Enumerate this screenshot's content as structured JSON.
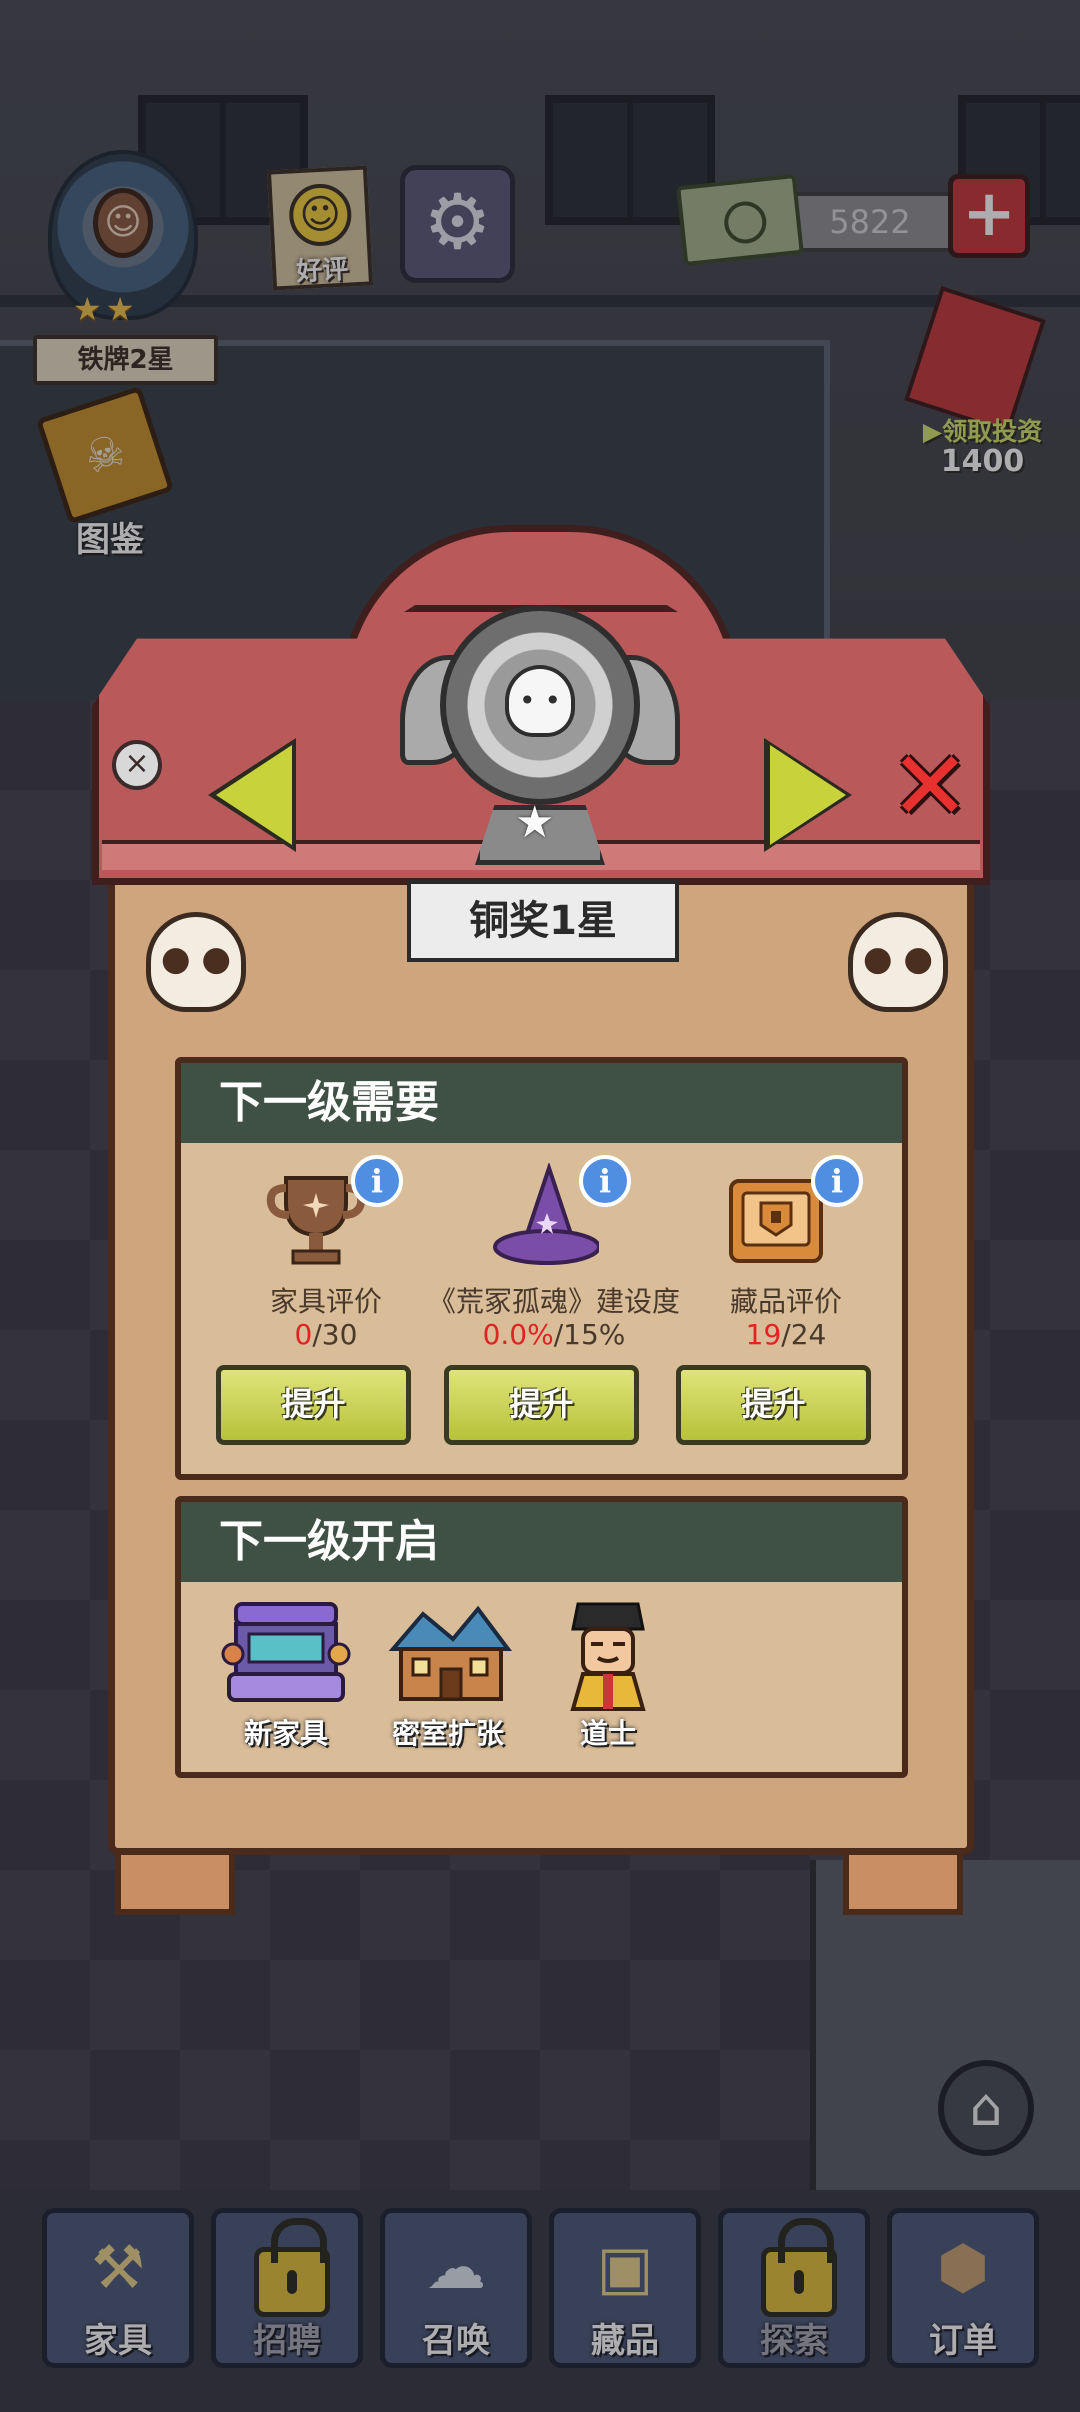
{
  "hud": {
    "rank_label": "铁牌2星",
    "review_label": "好评",
    "money": "5822",
    "invest_label": "领取投资",
    "invest_amount": "1400",
    "book_label": "图鉴"
  },
  "panel": {
    "title": "铜奖1星",
    "requirements": {
      "heading": "下一级需要",
      "items": [
        {
          "label": "家具评价",
          "current": "0",
          "target": "/30",
          "button": "提升",
          "icon": "trophy-icon"
        },
        {
          "label": "《荒冢孤魂》建设度",
          "current": "0.0%",
          "target": "/15%",
          "button": "提升",
          "icon": "witch-hat-icon"
        },
        {
          "label": "藏品评价",
          "current": "19",
          "target": "/24",
          "button": "提升",
          "icon": "chest-icon"
        }
      ]
    },
    "unlocks": {
      "heading": "下一级开启",
      "items": [
        {
          "label": "新家具",
          "icon": "furniture-icon"
        },
        {
          "label": "密室扩张",
          "icon": "house-icon"
        },
        {
          "label": "道士",
          "icon": "taoist-icon"
        }
      ]
    }
  },
  "nav": {
    "items": [
      {
        "label": "家具",
        "locked": false
      },
      {
        "label": "招聘",
        "locked": true
      },
      {
        "label": "召唤",
        "locked": false
      },
      {
        "label": "藏品",
        "locked": false
      },
      {
        "label": "探索",
        "locked": true
      },
      {
        "label": "订单",
        "locked": false
      }
    ]
  },
  "colors": {
    "accent_red": "#e02424",
    "button_green": "#c8d23a",
    "section_header": "#3f5044",
    "info_blue": "#4f8ee0"
  }
}
